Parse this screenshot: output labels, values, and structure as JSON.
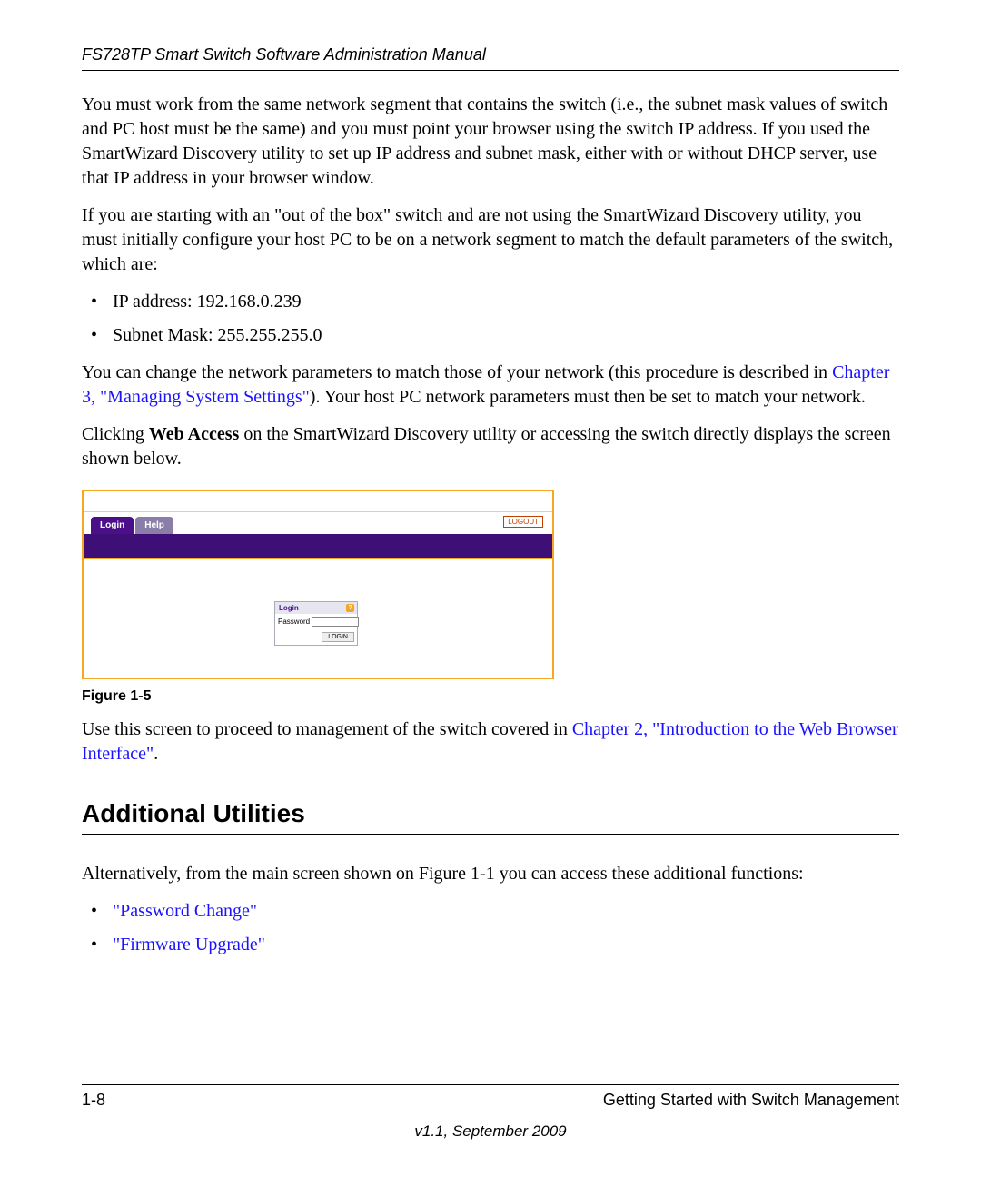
{
  "header": {
    "running_head": "FS728TP Smart Switch Software Administration Manual"
  },
  "para1": "You must work from the same network segment that contains the switch (i.e., the subnet mask values of switch and PC host must be the same) and you must point your browser using the switch IP address. If you used the SmartWizard Discovery utility to set up IP address and subnet mask, either with or without DHCP server, use that IP address in your browser window.",
  "para2": "If you are starting with an \"out of the box\" switch and are not using the SmartWizard Discovery utility, you must initially configure your host PC to be on a network segment to match the default parameters of the switch, which are:",
  "defaults": [
    "IP address: 192.168.0.239",
    "Subnet Mask: 255.255.255.0"
  ],
  "para3_pre": "You can change the network parameters to match those of your network (this procedure is described in ",
  "para3_link": "Chapter 3, \"Managing System Settings\"",
  "para3_post": "). Your host PC network parameters must then be set to match your network.",
  "para4_pre": "Clicking ",
  "para4_bold": "Web Access",
  "para4_post": " on the SmartWizard Discovery utility or accessing the switch directly displays the screen shown below.",
  "login_screen": {
    "tab_login": "Login",
    "tab_help": "Help",
    "logout": "LOGOUT",
    "box_title": "Login",
    "password_label": "Password",
    "login_button": "LOGIN"
  },
  "figure_caption": "Figure 1-5",
  "para5_pre": "Use this screen to proceed to management of the switch covered in ",
  "para5_link": "Chapter 2, \"Introduction to the Web Browser Interface\"",
  "para5_post": ".",
  "section_heading": "Additional Utilities",
  "para6": "Alternatively, from the main screen shown on Figure 1-1 you can access these additional functions:",
  "util_links": [
    "\"Password Change\"",
    "\"Firmware Upgrade\""
  ],
  "footer": {
    "page_num": "1-8",
    "chapter": "Getting Started with Switch Management",
    "version": "v1.1, September 2009"
  }
}
